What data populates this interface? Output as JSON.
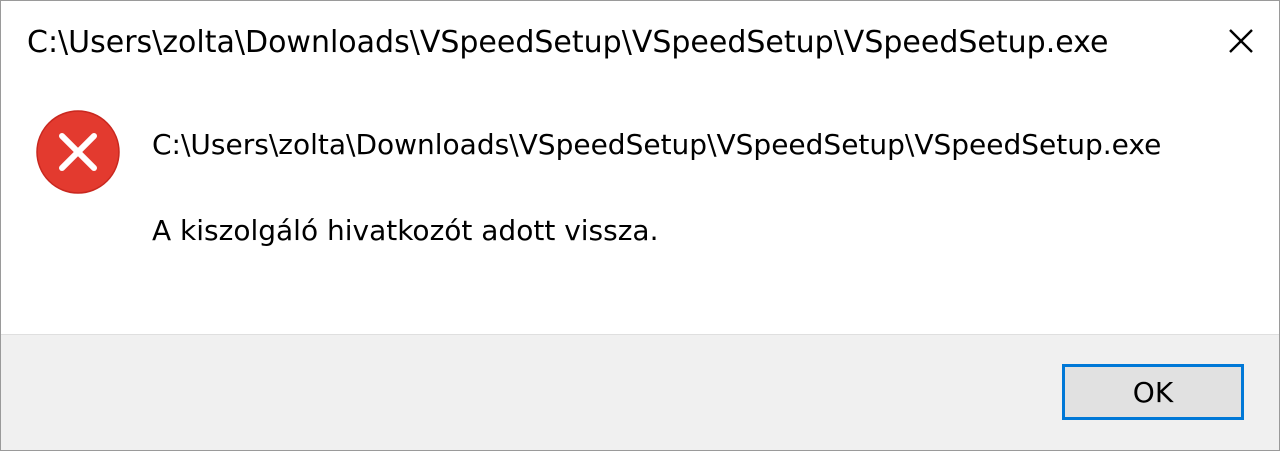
{
  "window": {
    "title": "C:\\Users\\zolta\\Downloads\\VSpeedSetup\\VSpeedSetup\\VSpeedSetup.exe",
    "close_icon": "close-icon"
  },
  "message": {
    "icon": "error-icon",
    "path": "C:\\Users\\zolta\\Downloads\\VSpeedSetup\\VSpeedSetup\\VSpeedSetup.exe",
    "text": "A kiszolgáló hivatkozót adott vissza."
  },
  "buttons": {
    "ok_label": "OK"
  },
  "colors": {
    "error_red": "#e33a2f",
    "accent_blue": "#0078d7",
    "footer_bg": "#f0f0f0"
  }
}
